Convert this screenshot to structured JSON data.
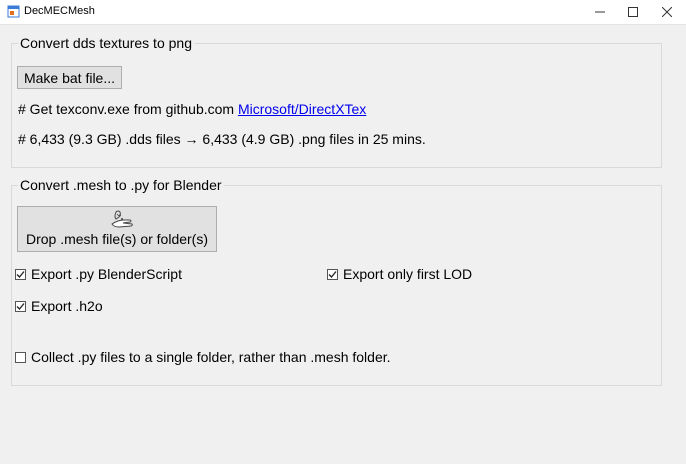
{
  "window": {
    "title": "DecMECMesh",
    "controls": {
      "minimize": "minimize",
      "maximize": "maximize",
      "close": "close"
    }
  },
  "dds_group": {
    "title": "Convert dds textures to png",
    "make_bat_label": "Make bat file...",
    "texconv_prefix": "# Get texconv.exe from github.com ",
    "texconv_link": "Microsoft/DirectXTex",
    "stats": "# 6,433 (9.3 GB) .dds files → 6,433 (4.9 GB) .png files in 25 mins."
  },
  "mesh_group": {
    "title": "Convert .mesh to .py for Blender",
    "drop_label": "Drop .mesh file(s) or folder(s)",
    "export_py": {
      "label": "Export .py  BlenderScript",
      "checked": true
    },
    "export_first_lod": {
      "label": "Export only first LOD",
      "checked": true
    },
    "export_h2o": {
      "label": "Export .h2o",
      "checked": true
    },
    "collect_single_folder": {
      "label": "Collect .py files to a single folder, rather than .mesh folder.",
      "checked": false
    }
  },
  "icons": {
    "app": "app-icon",
    "drop": "drop-hand-icon"
  }
}
